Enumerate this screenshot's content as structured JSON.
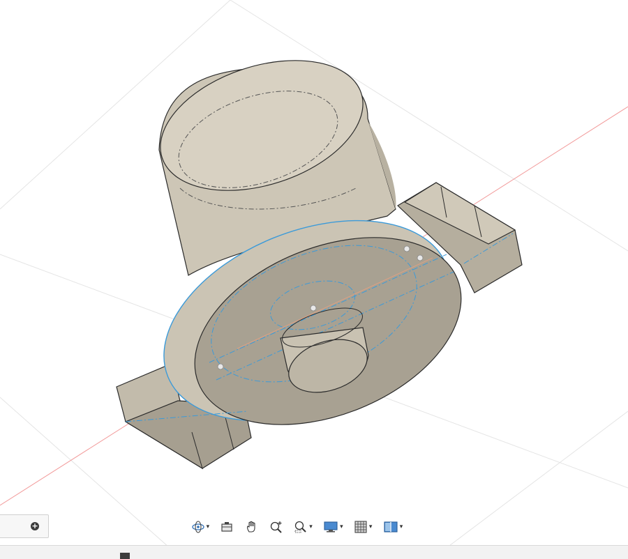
{
  "viewport": {
    "name": "3D model canvas",
    "axis_color": "#f29a9a",
    "model_face_color": "#cdc6b6",
    "model_edge_color": "#2a2a2a",
    "sketch_line_color": "#3b9ad9"
  },
  "comments_panel": {
    "add_icon": "plus-circle-icon"
  },
  "nav_toolbar": {
    "tools": [
      {
        "id": "orbit",
        "icon": "orbit-icon",
        "has_menu": true
      },
      {
        "id": "look-at",
        "icon": "look-at-icon",
        "has_menu": false
      },
      {
        "id": "pan",
        "icon": "hand-pan-icon",
        "has_menu": false
      },
      {
        "id": "zoom",
        "icon": "zoom-icon",
        "has_menu": false
      },
      {
        "id": "fit",
        "icon": "zoom-window-icon",
        "has_menu": true
      },
      {
        "id": "display-settings",
        "icon": "monitor-icon",
        "has_menu": true
      },
      {
        "id": "grid-snaps",
        "icon": "grid-icon",
        "has_menu": true
      },
      {
        "id": "viewports",
        "icon": "viewports-icon",
        "has_menu": true
      }
    ],
    "caret": "▾"
  },
  "status_bar": {
    "marker_icon": "timeline-marker-icon"
  }
}
